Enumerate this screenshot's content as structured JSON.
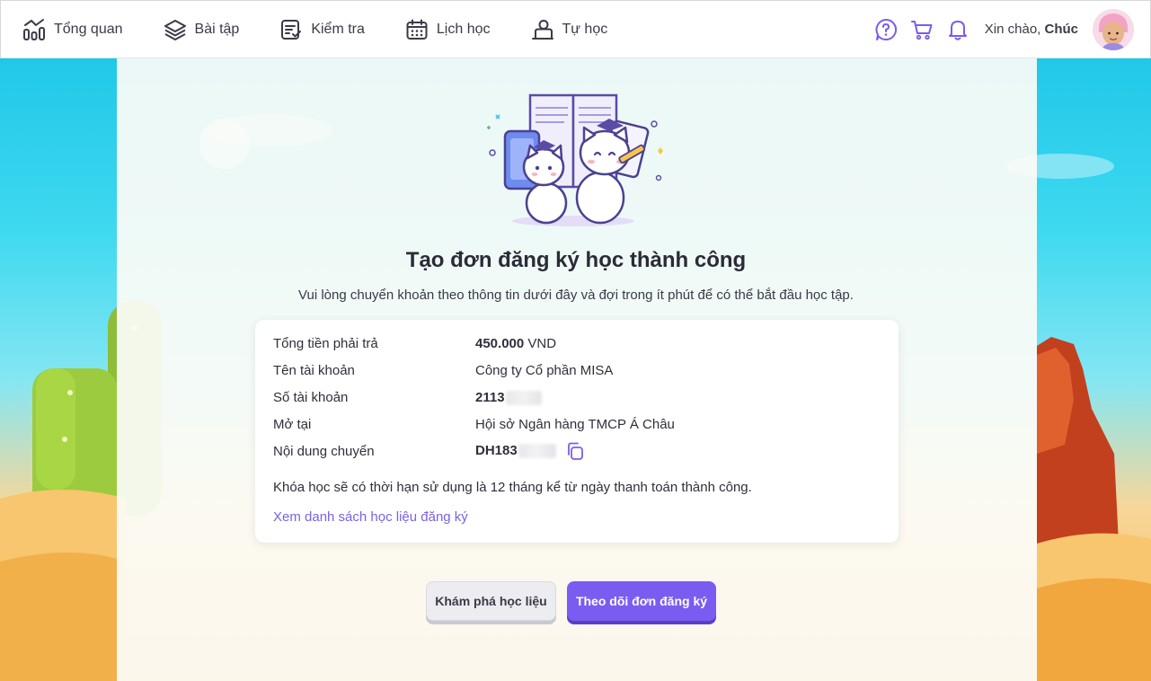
{
  "nav": {
    "items": [
      {
        "label": "Tổng quan",
        "icon": "chart-icon"
      },
      {
        "label": "Bài tập",
        "icon": "layers-icon"
      },
      {
        "label": "Kiểm tra",
        "icon": "checklist-icon"
      },
      {
        "label": "Lịch học",
        "icon": "calendar-icon"
      },
      {
        "label": "Tự học",
        "icon": "self-study-icon"
      }
    ]
  },
  "header": {
    "greeting_prefix": "Xin chào,",
    "user_name": "Chúc",
    "icons": [
      "help-icon",
      "cart-icon",
      "bell-icon"
    ]
  },
  "main": {
    "title": "Tạo đơn đăng ký học thành công",
    "subtitle": "Vui lòng chuyển khoản theo thông tin dưới đây và đợi trong ít phút để có thể bắt đầu học tập.",
    "payment": {
      "amount_label": "Tổng tiền phải trả",
      "amount_value": "450.000",
      "amount_currency": "VND",
      "account_name_label": "Tên tài khoản",
      "account_name_value": "Công ty Cổ phần MISA",
      "account_number_label": "Số tài khoản",
      "account_number_value": "2113",
      "bank_label": "Mở tại",
      "bank_value": "Hội sở Ngân hàng TMCP Á Châu",
      "transfer_content_label": "Nội dung chuyển",
      "transfer_content_value": "DH183"
    },
    "note": "Khóa học sẽ có thời hạn sử dụng là 12 tháng kể từ ngày thanh toán thành công.",
    "link": "Xem danh sách học liệu đăng ký",
    "buttons": {
      "secondary": "Khám phá học liệu",
      "primary": "Theo dõi đơn đăng ký"
    }
  },
  "colors": {
    "accent": "#7b5cf0",
    "link": "#7b61e8",
    "sky": "#20c8e8",
    "sand": "#f6b34f"
  }
}
